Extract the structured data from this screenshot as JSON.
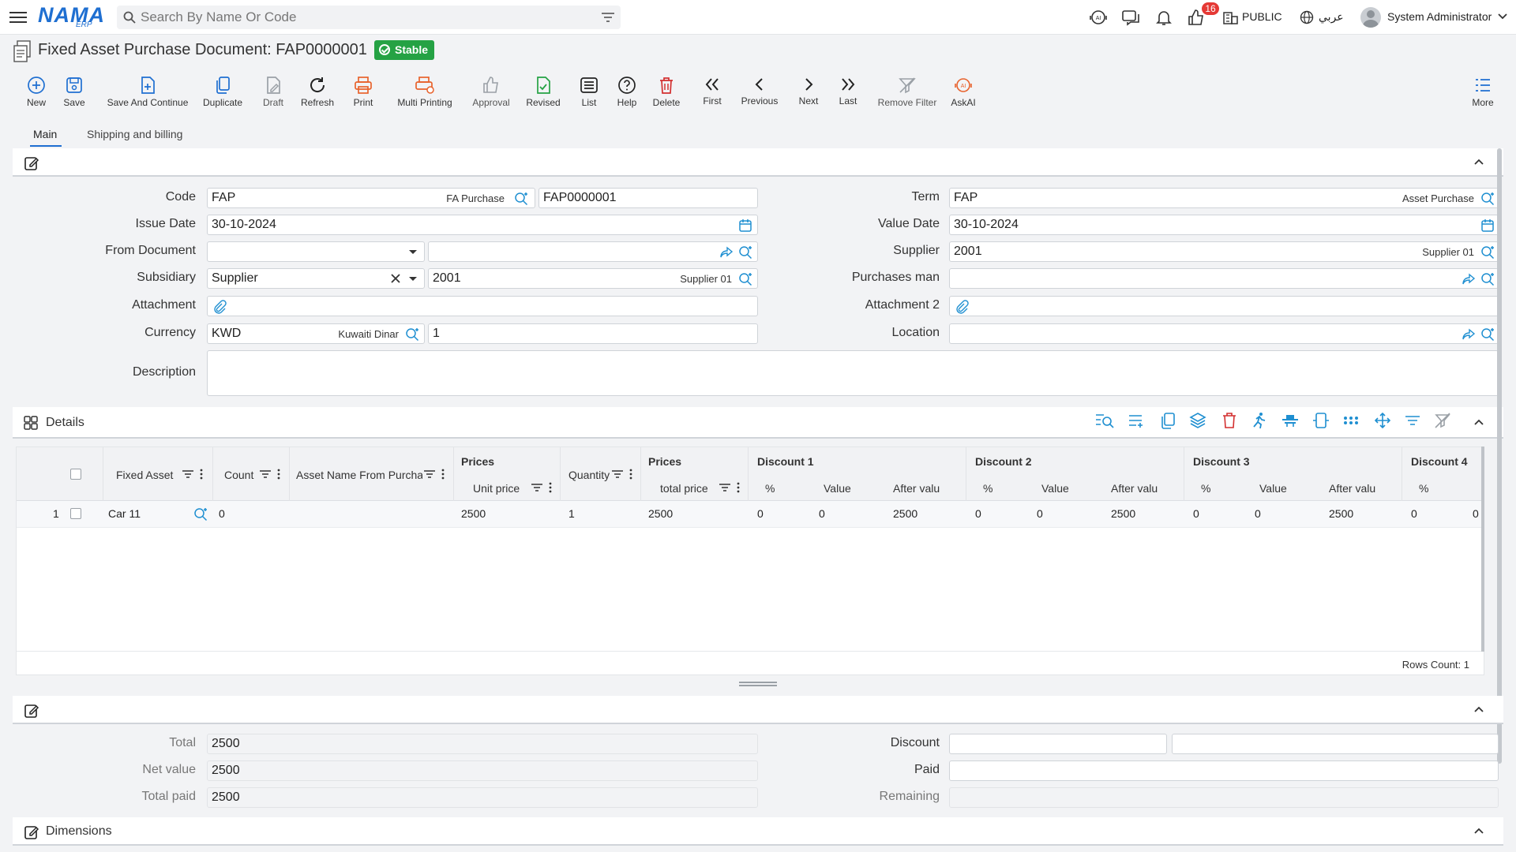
{
  "app": {
    "logo_text": "NAMA",
    "logo_sub": "ERP",
    "search_placeholder": "Search By Name Or Code",
    "notification_count": "16",
    "branch": "PUBLIC",
    "language": "عربي",
    "user": "System Administrator"
  },
  "page": {
    "title": "Fixed Asset Purchase Document: FAP0000001",
    "status": "Stable"
  },
  "toolbar": [
    {
      "label": "New",
      "icon": "plus-circle-icon",
      "color": "#1f6fd1"
    },
    {
      "label": "Save",
      "icon": "save-icon",
      "color": "#1f6fd1"
    },
    {
      "label": "Save And Continue",
      "icon": "save-continue-icon",
      "color": "#1f6fd1"
    },
    {
      "label": "Duplicate",
      "icon": "duplicate-icon",
      "color": "#1f6fd1"
    },
    {
      "label": "Draft",
      "icon": "draft-icon",
      "color": "#9aa0a6"
    },
    {
      "label": "Refresh",
      "icon": "refresh-icon",
      "color": "#222222"
    },
    {
      "label": "Print",
      "icon": "print-icon",
      "color": "#e8622c"
    },
    {
      "label": "Multi Printing",
      "icon": "multi-print-icon",
      "color": "#e8622c"
    },
    {
      "label": "Approval",
      "icon": "thumbs-up-icon",
      "color": "#9aa0a6"
    },
    {
      "label": "Revised",
      "icon": "revised-icon",
      "color": "#25a244"
    },
    {
      "label": "List",
      "icon": "list-icon",
      "color": "#222222"
    },
    {
      "label": "Help",
      "icon": "help-icon",
      "color": "#222222"
    },
    {
      "label": "Delete",
      "icon": "trash-icon",
      "color": "#d32f2f"
    },
    {
      "label": "First",
      "icon": "first-icon",
      "color": "#222222"
    },
    {
      "label": "Previous",
      "icon": "previous-icon",
      "color": "#222222"
    },
    {
      "label": "Next",
      "icon": "next-icon",
      "color": "#222222"
    },
    {
      "label": "Last",
      "icon": "last-icon",
      "color": "#222222"
    },
    {
      "label": "Remove Filter",
      "icon": "remove-filter-icon",
      "color": "#9aa0a6"
    },
    {
      "label": "AskAI",
      "icon": "ai-icon",
      "color": "#e8622c"
    },
    {
      "label": "More",
      "icon": "more-icon",
      "color": "#1f6fd1"
    }
  ],
  "tabs": [
    "Main",
    "Shipping and billing"
  ],
  "form": {
    "code": {
      "label": "Code",
      "value": "FAP",
      "tag": "FA Purchase",
      "number": "FAP0000001"
    },
    "issue_date": {
      "label": "Issue Date",
      "value": "30-10-2024"
    },
    "from_document": {
      "label": "From Document",
      "value": ""
    },
    "subsidiary": {
      "label": "Subsidiary",
      "value": "Supplier",
      "code": "2001",
      "tag": "Supplier 01"
    },
    "attachment": {
      "label": "Attachment"
    },
    "currency": {
      "label": "Currency",
      "value": "KWD",
      "tag": "Kuwaiti Dinar",
      "rate": "1"
    },
    "description": {
      "label": "Description",
      "value": ""
    },
    "term": {
      "label": "Term",
      "value": "FAP",
      "tag": "Asset Purchase"
    },
    "value_date": {
      "label": "Value Date",
      "value": "30-10-2024"
    },
    "supplier": {
      "label": "Supplier",
      "value": "2001",
      "tag": "Supplier 01"
    },
    "purchases_man": {
      "label": "Purchases man",
      "value": ""
    },
    "attachment2": {
      "label": "Attachment 2"
    },
    "location": {
      "label": "Location",
      "value": ""
    }
  },
  "details": {
    "title": "Details",
    "group_headers": [
      "Prices",
      "Prices",
      "Discount 1",
      "Discount 2",
      "Discount 3",
      "Discount 4"
    ],
    "columns": [
      "Fixed Asset",
      "Count",
      "Asset Name From Purcha",
      "Unit price",
      "Quantity",
      "total price",
      "%",
      "Value",
      "After valu",
      "%",
      "Value",
      "After valu",
      "%",
      "Value",
      "After valu",
      "%"
    ],
    "rows": [
      {
        "index": "1",
        "fixed_asset": "Car 11",
        "count": "0",
        "asset_name": "",
        "unit_price": "2500",
        "quantity": "1",
        "total_price": "2500",
        "d1_pct": "0",
        "d1_val": "0",
        "d1_after": "2500",
        "d2_pct": "0",
        "d2_val": "0",
        "d2_after": "2500",
        "d3_pct": "0",
        "d3_val": "0",
        "d3_after": "2500",
        "d4_pct": "0",
        "d4_val": "0"
      }
    ],
    "rows_count": "Rows Count: 1"
  },
  "totals": {
    "total": {
      "label": "Total",
      "value": "2500"
    },
    "net_value": {
      "label": "Net value",
      "value": "2500"
    },
    "total_paid": {
      "label": "Total paid",
      "value": "2500"
    },
    "discount": {
      "label": "Discount",
      "value": ""
    },
    "paid": {
      "label": "Paid",
      "value": ""
    },
    "remaining": {
      "label": "Remaining",
      "value": ""
    }
  },
  "dimensions": {
    "title": "Dimensions"
  }
}
